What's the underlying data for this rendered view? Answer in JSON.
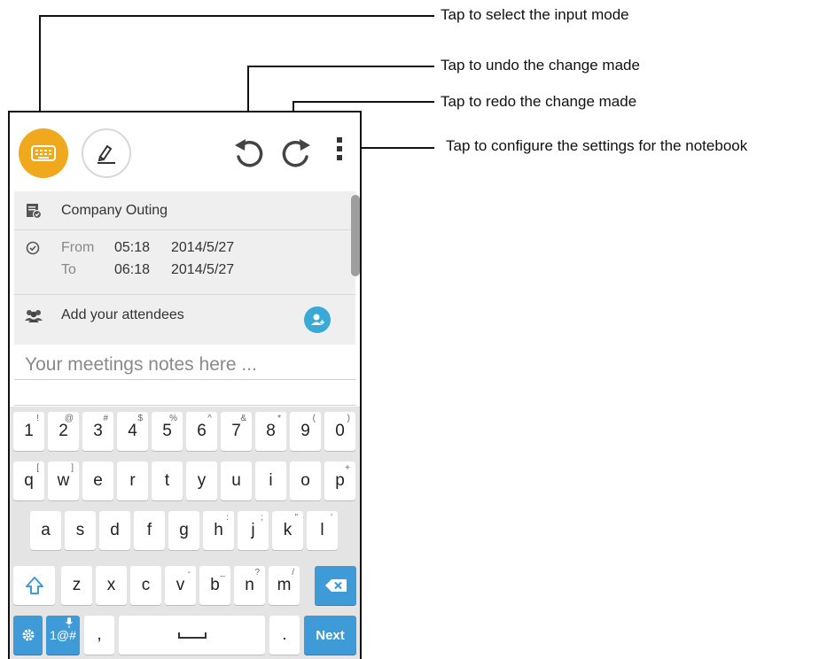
{
  "callouts": {
    "input_mode": "Tap to select the input mode",
    "undo": "Tap to undo the change made",
    "redo": "Tap to redo the change made",
    "settings": "Tap to configure the settings for the notebook"
  },
  "toolbar": {
    "input_mode_icon": "keyboard-icon",
    "handwriting_icon": "pen-handwriting-icon",
    "undo_icon": "undo-icon",
    "redo_icon": "redo-icon",
    "menu_icon": "more-vert-icon",
    "accent_color": "#f0a81c"
  },
  "event": {
    "title": "Company Outing",
    "from_label": "From",
    "from_time": "05:18",
    "from_date": "2014/5/27",
    "to_label": "To",
    "to_time": "06:18",
    "to_date": "2014/5/27",
    "attendees_placeholder": "Add your attendees"
  },
  "notes": {
    "placeholder": "Your meetings notes here ..."
  },
  "keyboard": {
    "row1": [
      {
        "k": "1",
        "s": "!"
      },
      {
        "k": "2",
        "s": "@"
      },
      {
        "k": "3",
        "s": "#"
      },
      {
        "k": "4",
        "s": "$"
      },
      {
        "k": "5",
        "s": "%"
      },
      {
        "k": "6",
        "s": "^"
      },
      {
        "k": "7",
        "s": "&"
      },
      {
        "k": "8",
        "s": "*"
      },
      {
        "k": "9",
        "s": "("
      },
      {
        "k": "0",
        "s": ")"
      }
    ],
    "row2": [
      {
        "k": "q",
        "s": "["
      },
      {
        "k": "w",
        "s": "]"
      },
      {
        "k": "e",
        "s": ""
      },
      {
        "k": "r",
        "s": ""
      },
      {
        "k": "t",
        "s": ""
      },
      {
        "k": "y",
        "s": ""
      },
      {
        "k": "u",
        "s": ""
      },
      {
        "k": "i",
        "s": ""
      },
      {
        "k": "o",
        "s": ""
      },
      {
        "k": "p",
        "s": "+"
      }
    ],
    "row3": [
      {
        "k": "a",
        "s": ""
      },
      {
        "k": "s",
        "s": ""
      },
      {
        "k": "d",
        "s": ""
      },
      {
        "k": "f",
        "s": ""
      },
      {
        "k": "g",
        "s": ""
      },
      {
        "k": "h",
        "s": ":"
      },
      {
        "k": "j",
        "s": ";"
      },
      {
        "k": "k",
        "s": "\""
      },
      {
        "k": "l",
        "s": "'"
      }
    ],
    "row4": [
      {
        "k": "z",
        "s": ""
      },
      {
        "k": "x",
        "s": ""
      },
      {
        "k": "c",
        "s": ""
      },
      {
        "k": "v",
        "s": "-"
      },
      {
        "k": "b",
        "s": "_"
      },
      {
        "k": "n",
        "s": "?"
      },
      {
        "k": "m",
        "s": "/"
      }
    ],
    "symbols_label": "1@#",
    "comma": ",",
    "period": ".",
    "next_label": "Next",
    "key_accent": "#3f9bd8"
  }
}
